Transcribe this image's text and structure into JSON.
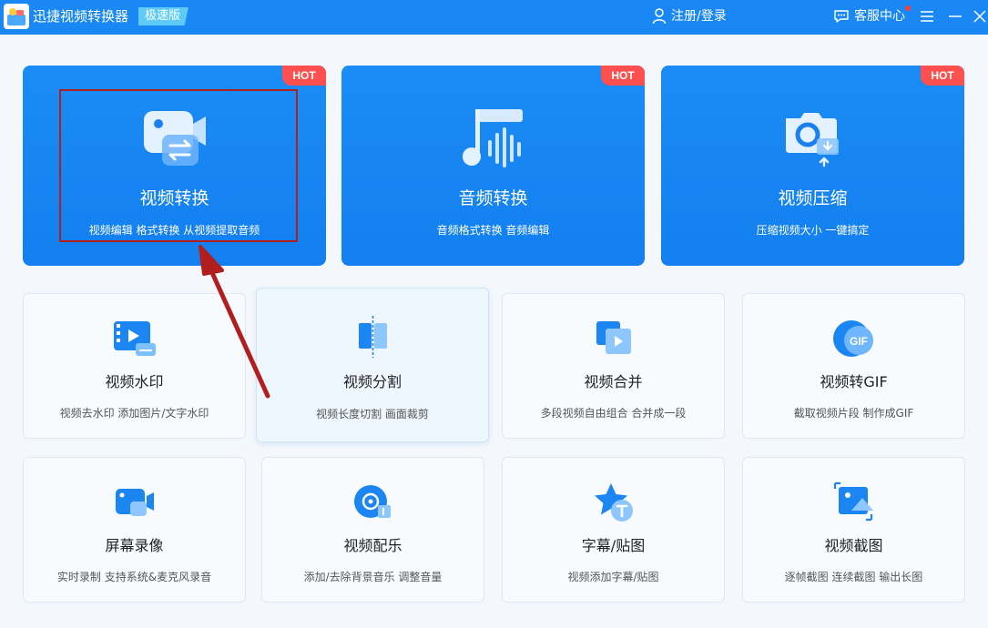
{
  "titlebar": {
    "app_title": "迅捷视频转换器",
    "edition": "极速版",
    "user_label": "注册/登录",
    "support_label": "客服中心",
    "bg_color": "#1a88f4"
  },
  "hot_label": "HOT",
  "big_cards": [
    {
      "title": "视频转换",
      "subtitle": "视频编辑 格式转换 从视频提取音频",
      "icon": "video-convert-icon"
    },
    {
      "title": "音频转换",
      "subtitle": "音频格式转换 音频编辑",
      "icon": "audio-convert-icon"
    },
    {
      "title": "视频压缩",
      "subtitle": "压缩视频大小 一键搞定",
      "icon": "video-compress-icon"
    }
  ],
  "small_cards": [
    {
      "title": "视频水印",
      "subtitle": "视频去水印 添加图片/文字水印",
      "icon": "watermark-icon"
    },
    {
      "title": "视频分割",
      "subtitle": "视频长度切割 画面裁剪",
      "icon": "split-icon"
    },
    {
      "title": "视频合并",
      "subtitle": "多段视频自由组合 合并成一段",
      "icon": "merge-icon"
    },
    {
      "title": "视频转GIF",
      "subtitle": "截取视频片段 制作成GIF",
      "icon": "gif-icon"
    },
    {
      "title": "屏幕录像",
      "subtitle": "实时录制 支持系统&麦克风录音",
      "icon": "screen-record-icon"
    },
    {
      "title": "视频配乐",
      "subtitle": "添加/去除背景音乐 调整音量",
      "icon": "music-icon"
    },
    {
      "title": "字幕/贴图",
      "subtitle": "视频添加字幕/贴图",
      "icon": "subtitle-sticker-icon"
    },
    {
      "title": "视频截图",
      "subtitle": "逐帧截图 连续截图 输出长图",
      "icon": "screenshot-icon"
    }
  ],
  "gif_icon_text": "GIF",
  "colors": {
    "accent": "#1a88f4",
    "hot": "#ff4f4f",
    "annotation": "#b21e1e"
  }
}
